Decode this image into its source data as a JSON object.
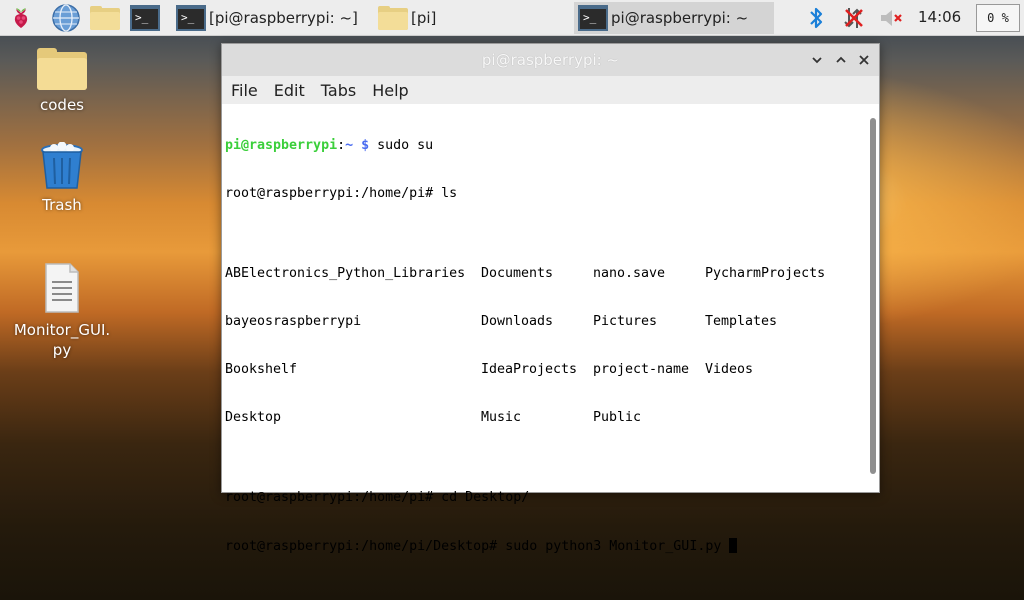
{
  "taskbar": {
    "windows": [
      {
        "label": "[pi@raspberrypi: ~]"
      },
      {
        "label": "[pi]"
      },
      {
        "label": "pi@raspberrypi: ~"
      }
    ],
    "clock": "14:06",
    "cpu": "0 %"
  },
  "desktop": {
    "items": [
      {
        "label": "codes"
      },
      {
        "label": "Trash"
      },
      {
        "label": "Monitor_GUI.py"
      }
    ]
  },
  "window": {
    "title": "pi@raspberrypi: ~",
    "menu": [
      "File",
      "Edit",
      "Tabs",
      "Help"
    ]
  },
  "terminal": {
    "prompt_user": "pi@raspberrypi",
    "prompt_sep": ":",
    "prompt_path": "~ $",
    "cmd1": " sudo su",
    "line2": "root@raspberrypi:/home/pi# ls",
    "ls_cols": [
      [
        "ABElectronics_Python_Libraries",
        "bayeosraspberrypi",
        "Bookshelf",
        "Desktop"
      ],
      [
        "Documents",
        "Downloads",
        "IdeaProjects",
        "Music"
      ],
      [
        "nano.save",
        "Pictures",
        "project-name",
        "Public"
      ],
      [
        "PycharmProjects",
        "Templates",
        "Videos",
        ""
      ]
    ],
    "line7": "root@raspberrypi:/home/pi# cd Desktop/",
    "line8": "root@raspberrypi:/home/pi/Desktop# sudo python3 Monitor_GUI.py "
  },
  "colors": {
    "prompt_user": "#3bcf3b",
    "prompt_path": "#4a6cf0"
  }
}
